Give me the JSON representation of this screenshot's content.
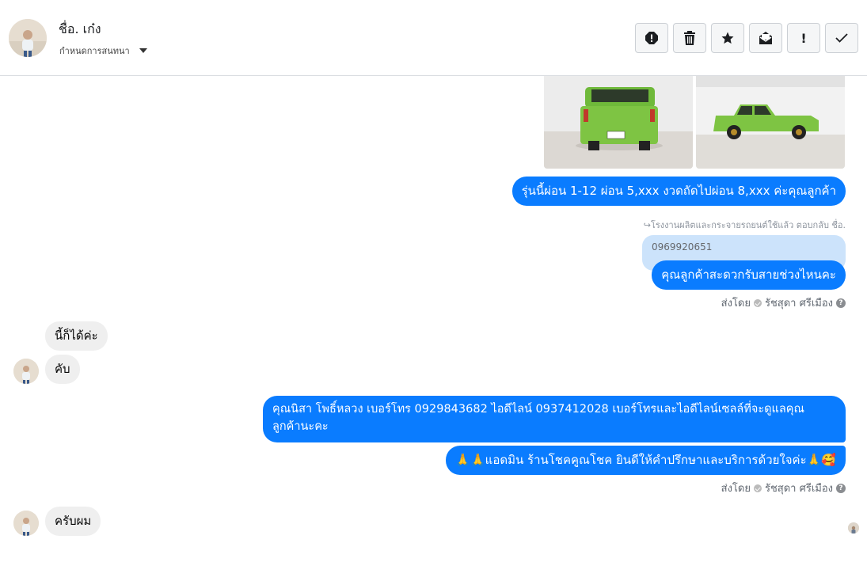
{
  "header": {
    "name": "ชื่อ. เก๋ง",
    "subtitle": "กำหนดการสนทนา"
  },
  "toolbar": [
    {
      "icon": "alert-circle-icon",
      "label": ""
    },
    {
      "icon": "trash-icon",
      "label": ""
    },
    {
      "icon": "star-icon",
      "label": ""
    },
    {
      "icon": "mark-unread-icon",
      "label": ""
    },
    {
      "icon": "exclamation-icon",
      "label": "!"
    },
    {
      "icon": "checkmark-icon",
      "label": ""
    }
  ],
  "messages": {
    "m1": "รุ่นนี้ผ่อน 1-12 ผ่อน 5,xxx งวดถัดไปผ่อน 8,xxx ค่ะคุณลูกค้า",
    "reply_note": "โรงงานผลิตและกระจายรถยนต์ใช้แล้ว ตอบกลับ ชื่อ.",
    "quoted": "0969920651",
    "m2": "คุณลูกค้าสะดวกรับสายช่วงไหนคะ",
    "sent_by_label": "ส่งโดย",
    "sender_name": "รัชสุดา ศรีเมือง",
    "in1": "นี้ก็ได้ค่ะ",
    "in2": "คับ",
    "m3_line1": "คุณนิสา โพธิ์หลวง  เบอร์โทร 0929843682  ไอดีไลน์ 0937412028   เบอร์โทรและไอดีไลน์เซลล์ที่จะดูแลคุณ",
    "m3_line2": "ลูกค้านะคะ",
    "m4": "🙏🙏แอดมิน ร้านโชคคูณโชค ยินดีให้คำปรึกษาและบริการด้วยใจค่ะ🙏🥰",
    "in3": "ครับผม"
  },
  "colors": {
    "outgoing": "#0a7cff",
    "incoming": "#efefef",
    "truck": "#7ec443"
  }
}
